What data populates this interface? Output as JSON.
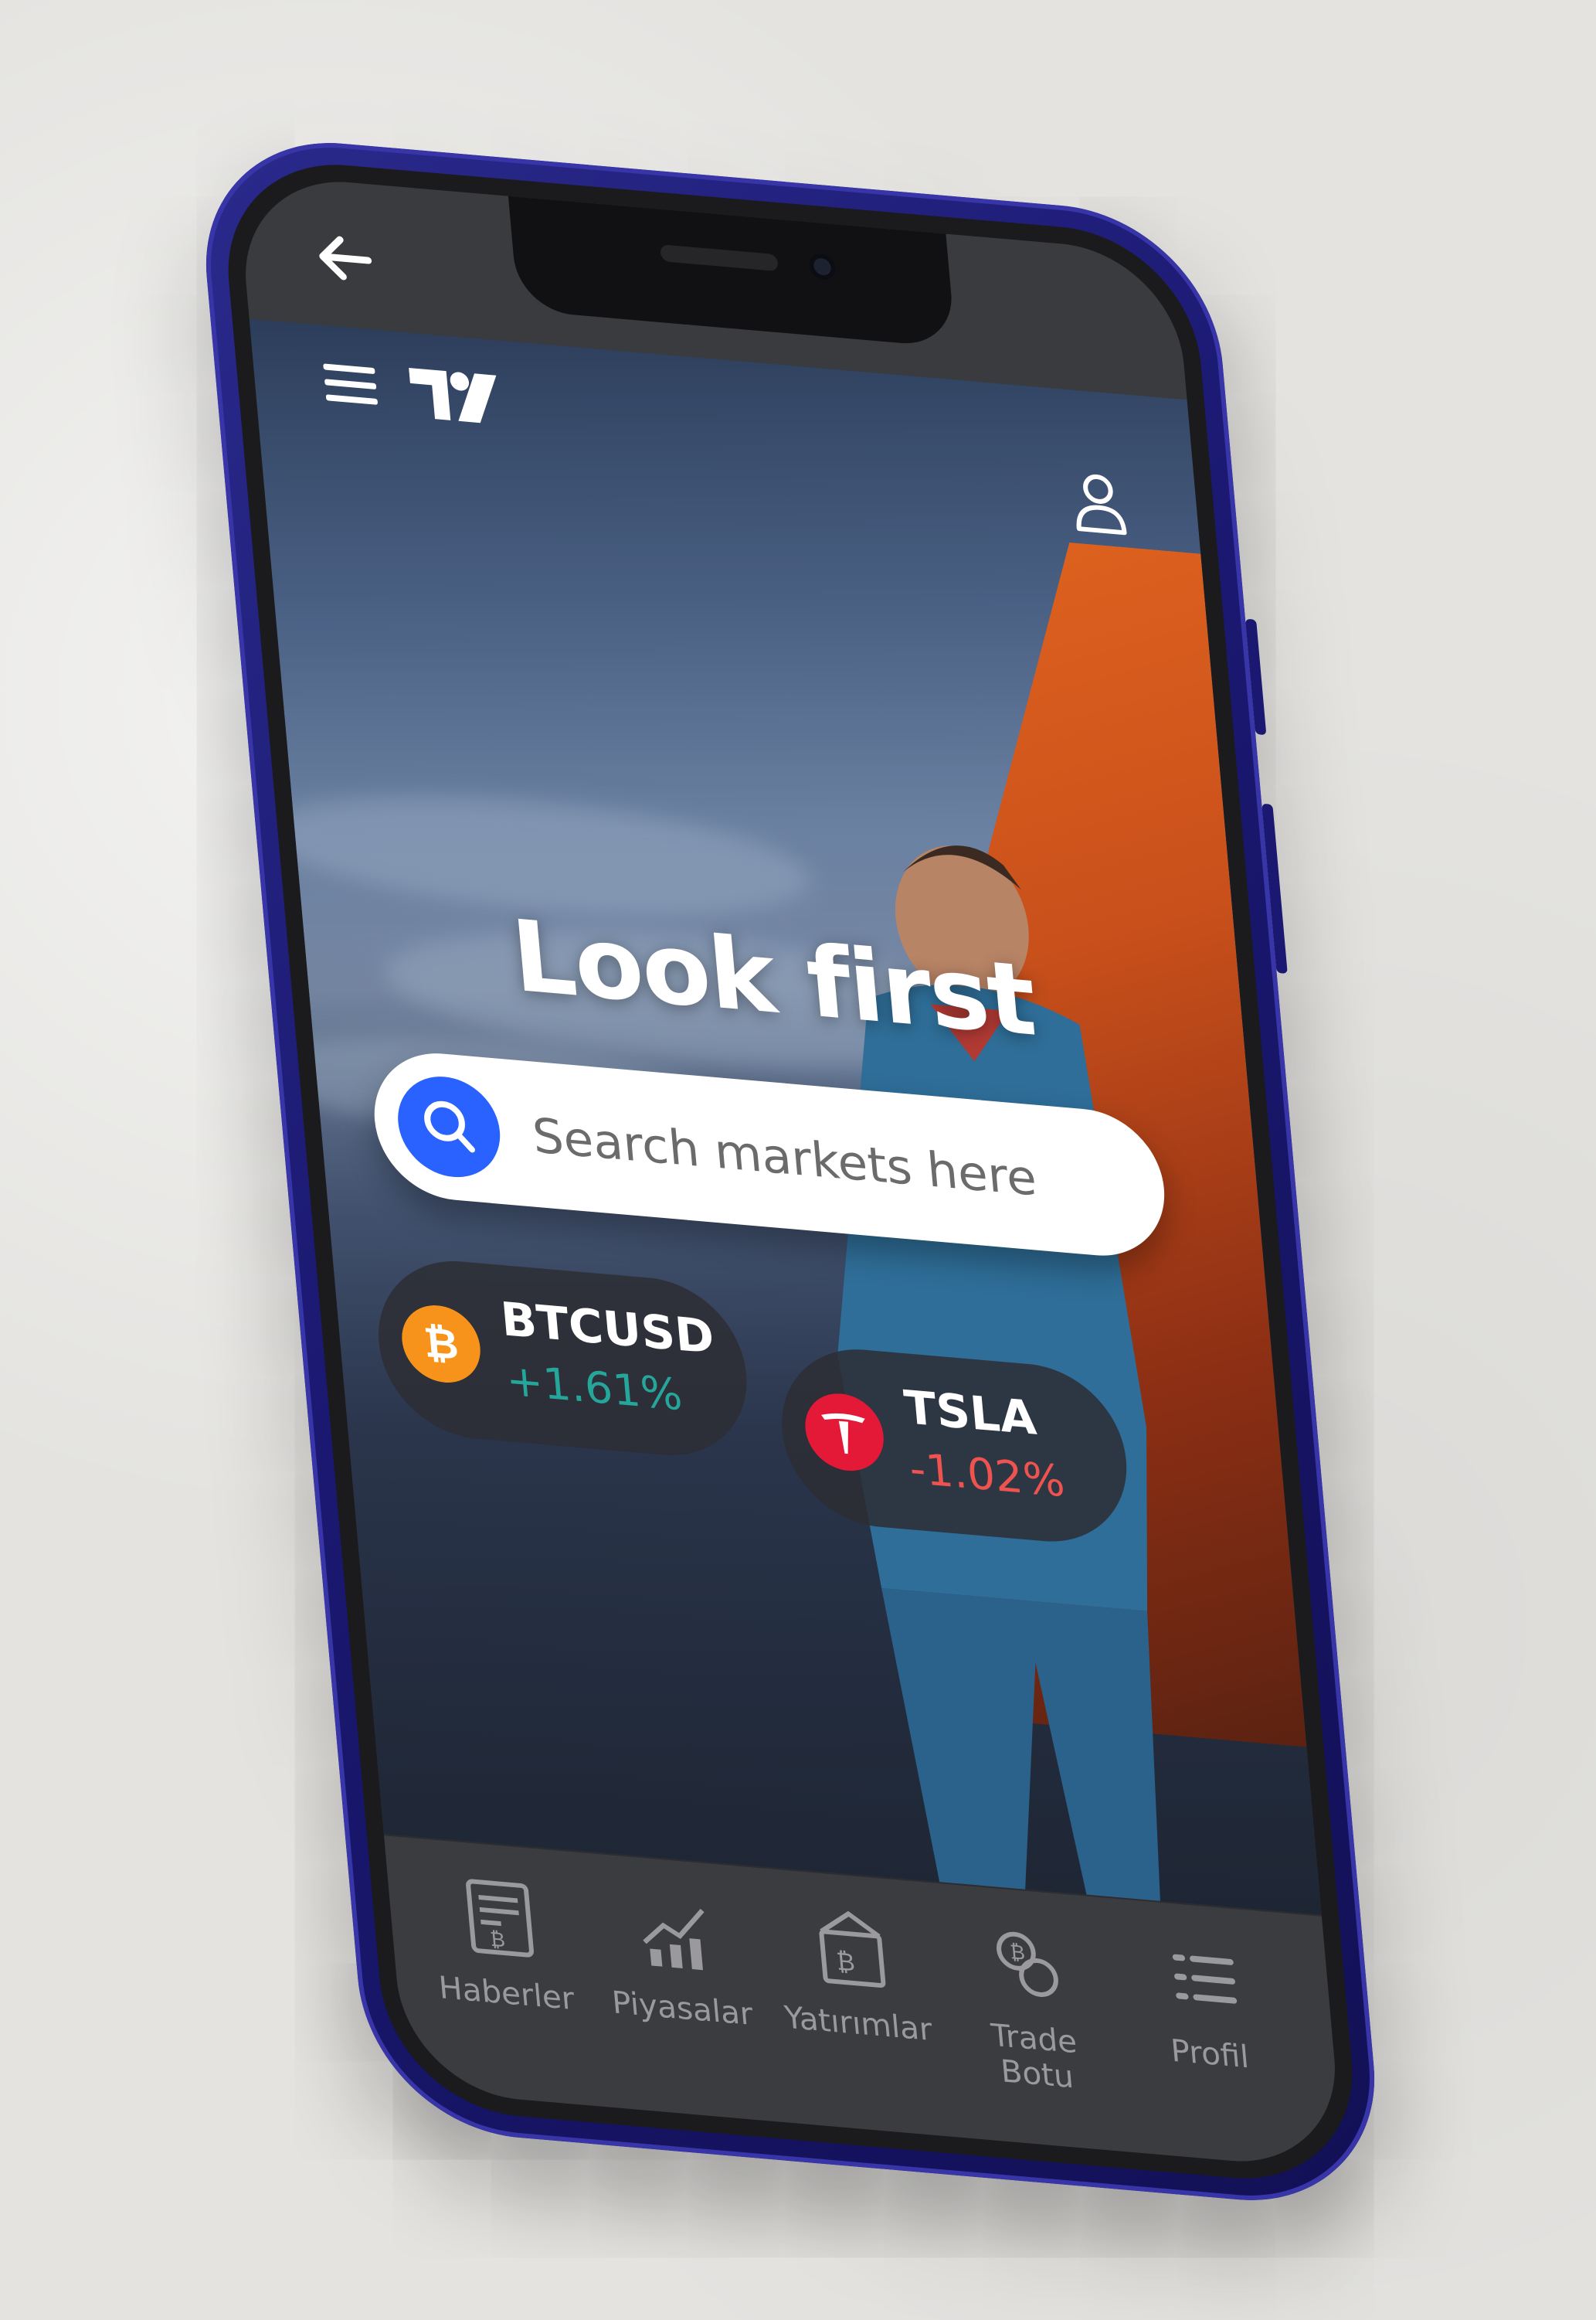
{
  "app": {
    "logo_text": "TV"
  },
  "nav": {
    "back_icon": "arrow-left-icon",
    "menu_icon": "hamburger-menu-icon",
    "user_icon": "user-icon"
  },
  "hero": {
    "headline": "Look first"
  },
  "search": {
    "placeholder": "Search markets here",
    "icon": "search-icon",
    "accent": "#2962ff"
  },
  "tickers": [
    {
      "symbol": "BTCUSD",
      "change": "+1.61%",
      "icon": "bitcoin-icon",
      "icon_color": "#f7931a",
      "change_color": "#26a69a"
    },
    {
      "symbol": "TSLA",
      "change": "-1.02%",
      "icon": "tesla-icon",
      "icon_color": "#e31937",
      "change_color": "#ef5350"
    }
  ],
  "tabs": [
    {
      "label": "Haberler",
      "icon": "newspaper-icon"
    },
    {
      "label": "Piyasalar",
      "icon": "market-chart-icon"
    },
    {
      "label": "Yatırımlar",
      "icon": "investment-icon"
    },
    {
      "label": "Trade Botu",
      "icon": "trade-bot-icon"
    },
    {
      "label": "Profil",
      "icon": "list-icon"
    }
  ]
}
